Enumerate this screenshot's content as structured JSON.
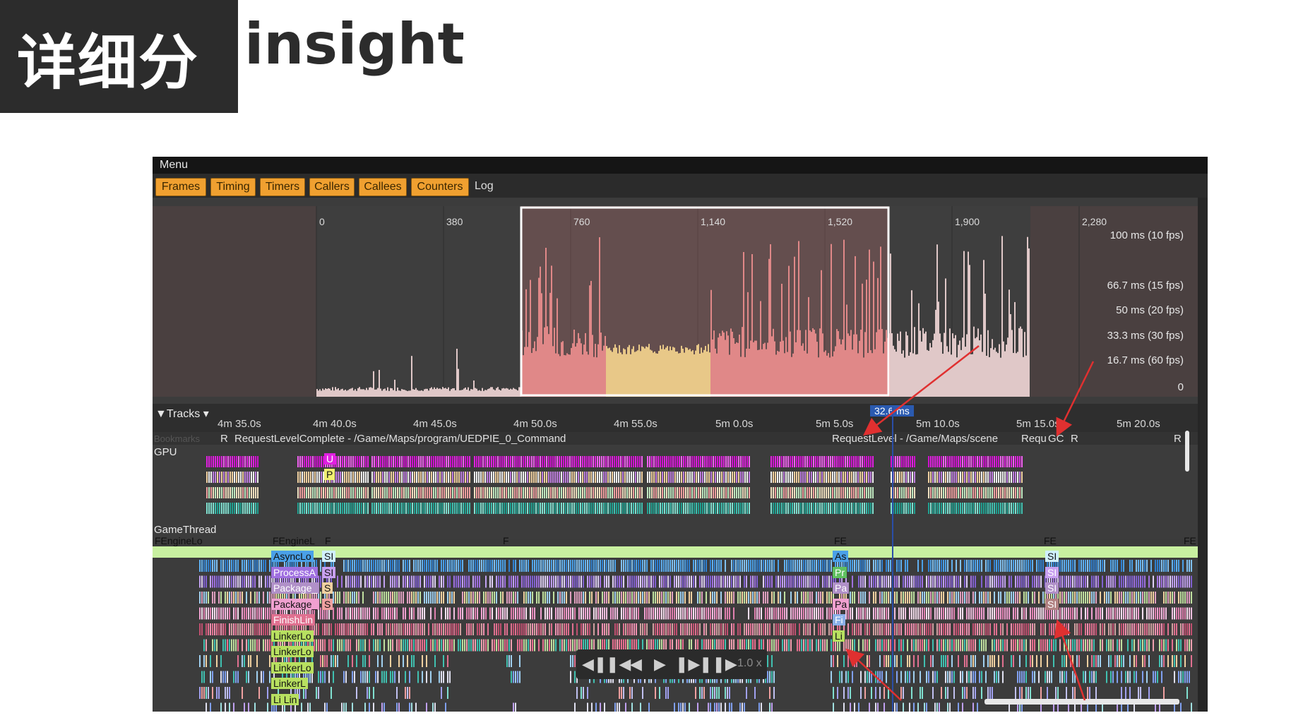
{
  "slide": {
    "title_cn": "详细分析",
    "title_en": "insight"
  },
  "menu": {
    "label": "Menu"
  },
  "tabs": [
    {
      "label": "Frames"
    },
    {
      "label": "Timing"
    },
    {
      "label": "Timers"
    },
    {
      "label": "Callers"
    },
    {
      "label": "Callees"
    },
    {
      "label": "Counters"
    }
  ],
  "log_tab": {
    "label": "Log"
  },
  "frames_axis": [
    "0",
    "380",
    "760",
    "1,140",
    "1,520",
    "1,900",
    "2,280"
  ],
  "fps_labels": [
    "100 ms (10 fps)",
    "66.7 ms (15 fps)",
    "50 ms (20 fps)",
    "33.3 ms (30 fps)",
    "16.7 ms (60 fps)",
    "0"
  ],
  "tracks": {
    "label": "Tracks",
    "time_labels": [
      "4m 35.0s",
      "4m 40.0s",
      "4m 45.0s",
      "4m 50.0s",
      "4m 55.0s",
      "5m 0.0s",
      "5m 5.0s",
      "5m 10.0s",
      "5m 15.0s",
      "5m 20.0s"
    ],
    "marker": "32.6 ms"
  },
  "bookmarks": {
    "faded": "Bookmarks",
    "r1": "R",
    "item1": "RequestLevelComplete - /Game/Maps/program/UEDPIE_0_Command",
    "item2": "RequestLevel - /Game/Maps/scene",
    "item3": "Requ",
    "item4": "GC",
    "item5": "R",
    "item6": "R"
  },
  "gpu": {
    "label": "GPU",
    "u": "U",
    "p": "P"
  },
  "game_thread": {
    "label": "GameThread",
    "top_left": "FEngineLo",
    "rows": [
      "FEngineL",
      "AsyncLo",
      "ProcessA",
      "Package_",
      "Package_",
      "FinishLin",
      "LinkerLo",
      "LinkerLo",
      "LinkerLo",
      "LinkerL",
      "Li  Lin"
    ],
    "f1": "F",
    "f2": "F",
    "fe1": "FE",
    "fe2": "FE",
    "fe3": "FE",
    "mid_labels": [
      "SI",
      "SI",
      "S",
      "S"
    ],
    "right_labels": [
      "As",
      "Pr",
      "Pa",
      "Pa",
      "Fi",
      "Li"
    ],
    "far_labels": [
      "SI",
      "SI",
      "SI",
      "SI"
    ]
  },
  "playback": {
    "speed": "1.0 x"
  },
  "colors": {
    "accent_tab": "#f0a030",
    "selection": "#e08080",
    "cursor": "#2a4ea8",
    "arrow": "#e03030"
  }
}
